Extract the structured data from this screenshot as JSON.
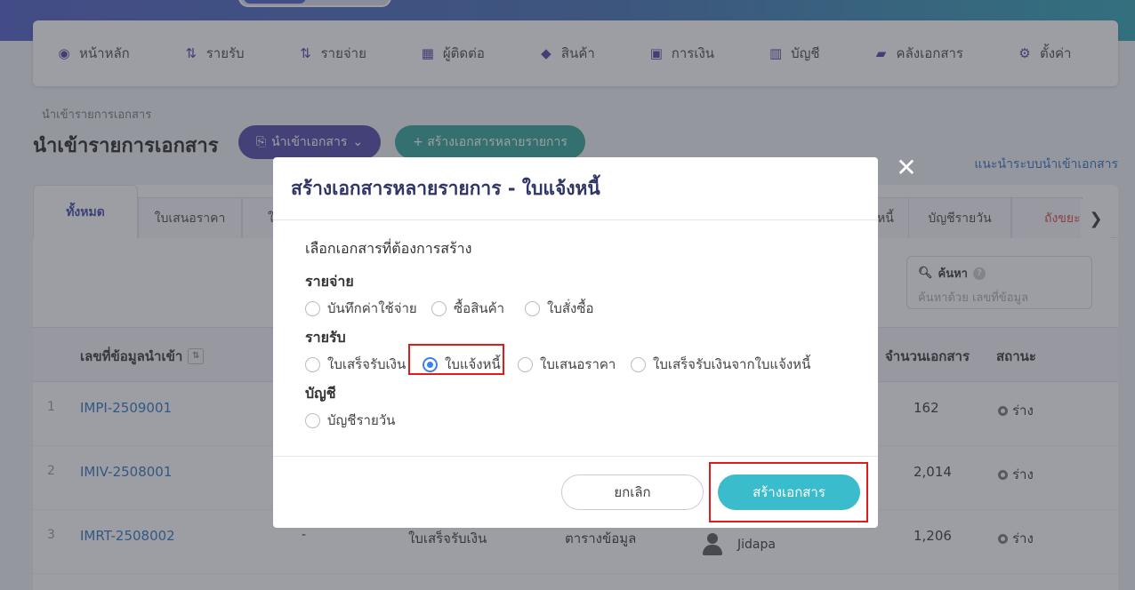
{
  "nav": [
    {
      "label": "หน้าหลัก",
      "icon": "dashboard-icon",
      "glyph": "◉"
    },
    {
      "label": "รายรับ",
      "icon": "income-list-icon",
      "glyph": "⇅"
    },
    {
      "label": "รายจ่าย",
      "icon": "expense-list-icon",
      "glyph": "⇅"
    },
    {
      "label": "ผู้ติดต่อ",
      "icon": "contacts-icon",
      "glyph": "▦"
    },
    {
      "label": "สินค้า",
      "icon": "product-box-icon",
      "glyph": "◆"
    },
    {
      "label": "การเงิน",
      "icon": "money-icon",
      "glyph": "▣"
    },
    {
      "label": "บัญชี",
      "icon": "ledger-icon",
      "glyph": "▥"
    },
    {
      "label": "คลังเอกสาร",
      "icon": "folder-icon",
      "glyph": "▰"
    },
    {
      "label": "ตั้งค่า",
      "icon": "gear-icon",
      "glyph": "⚙"
    }
  ],
  "page": {
    "breadcrumb": "นำเข้ารายการเอกสาร",
    "title": "นำเข้ารายการเอกสาร",
    "import_button": "นำเข้าเอกสาร",
    "multi_button": "+ สร้างเอกสารหลายรายการ",
    "guide_link": "แนะนำระบบนำเข้าเอกสาร"
  },
  "tabs": {
    "all": "ทั้งหมด",
    "quotation": "ใบเสนอราคา",
    "partial_hidden": "ใ",
    "invoice_partial": "หนี้",
    "journal": "บัญชีรายวัน",
    "trash": "ถังขยะ"
  },
  "search": {
    "label": "ค้นหา",
    "placeholder": "ค้นหาด้วย เลขที่ข้อมูล"
  },
  "table": {
    "headers": {
      "code": "เลขที่ข้อมูลนำเข้า",
      "count": "จำนวนเอกสาร",
      "status": "สถานะ"
    },
    "rows": [
      {
        "idx": "1",
        "code": "IMPI-2509001",
        "count": "162",
        "status": "ร่าง"
      },
      {
        "idx": "2",
        "code": "IMIV-2508001",
        "count": "2,014",
        "status": "ร่าง"
      },
      {
        "idx": "3",
        "code": "IMRT-2508002",
        "dash": "-",
        "type": "ใบเสร็จรับเงิน",
        "source": "ตารางข้อมูล",
        "user": "Jidapa",
        "count": "1,206",
        "status": "ร่าง"
      }
    ]
  },
  "modal": {
    "title": "สร้างเอกสารหลายรายการ - ใบแจ้งหนี้",
    "caption": "เลือกเอกสารที่ต้องการสร้าง",
    "expense_title": "รายจ่าย",
    "expense_options": [
      "บันทึกค่าใช้จ่าย",
      "ซื้อสินค้า",
      "ใบสั่งซื้อ"
    ],
    "income_title": "รายรับ",
    "income_options": [
      "ใบเสร็จรับเงิน",
      "ใบแจ้งหนี้",
      "ใบเสนอราคา",
      "ใบเสร็จรับเงินจากใบแจ้งหนี้"
    ],
    "income_selected": "ใบแจ้งหนี้",
    "account_title": "บัญชี",
    "account_options": [
      "บัญชีรายวัน"
    ],
    "cancel": "ยกเลิก",
    "create": "สร้างเอกสาร",
    "close_glyph": "✕"
  },
  "colors": {
    "accent": "#4a44a8",
    "teal": "#3bbccd",
    "highlight": "#e01b1b",
    "radio": "#3b82e8"
  }
}
